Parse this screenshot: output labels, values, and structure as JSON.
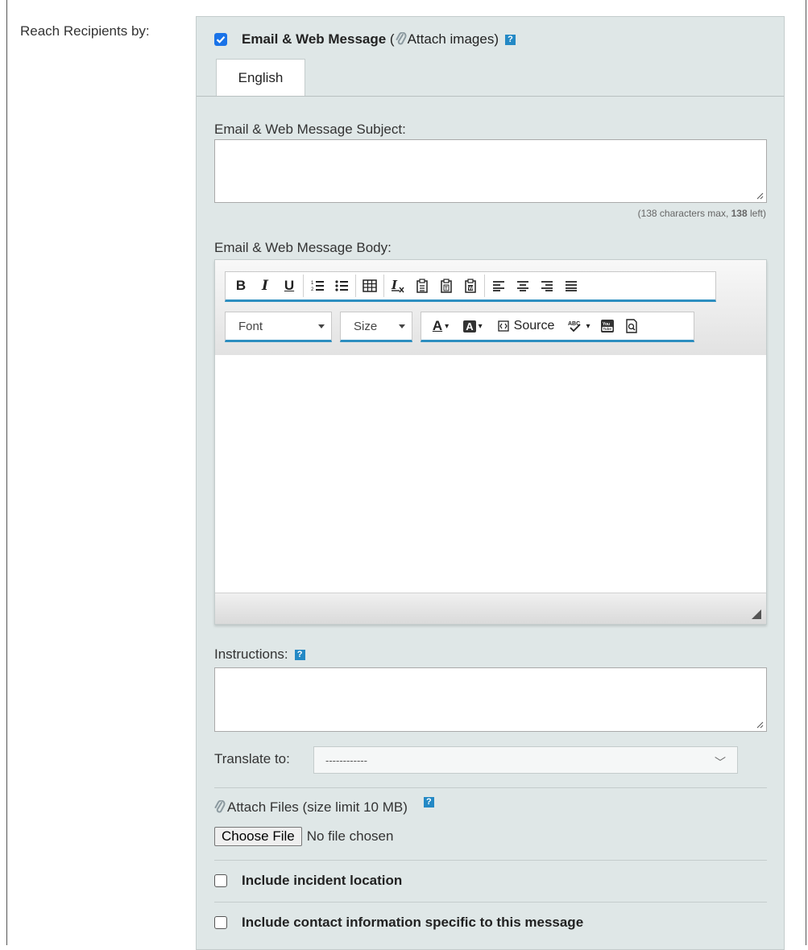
{
  "form": {
    "reach_label": "Reach Recipients by:"
  },
  "email": {
    "checkbox_label": "Email & Web Message",
    "paren_open": " (",
    "attach_images": "Attach images)",
    "help": "?",
    "checked": true
  },
  "tabs": [
    {
      "label": "English",
      "active": true
    }
  ],
  "subject": {
    "label": "Email & Web Message Subject:",
    "value": "",
    "hint_prefix": "(138 characters max, ",
    "hint_count": "138",
    "hint_suffix": " left)"
  },
  "body": {
    "label": "Email & Web Message Body:",
    "toolbar": {
      "bold": "B",
      "italic": "I",
      "underline": "U",
      "font": "Font",
      "size": "Size",
      "text_color": "A",
      "bg_color": "A",
      "source": "Source"
    },
    "icons": [
      "numbered-list-icon",
      "bulleted-list-icon",
      "table-icon",
      "remove-format-icon",
      "paste-icon",
      "paste-text-icon",
      "paste-word-icon",
      "align-left-icon",
      "align-center-icon",
      "align-right-icon",
      "justify-icon",
      "source-icon",
      "spellcheck-icon",
      "youtube-icon",
      "preview-icon"
    ]
  },
  "instructions": {
    "label": "Instructions:",
    "help": "?",
    "value": ""
  },
  "translate": {
    "label": "Translate to:",
    "selected": "------------"
  },
  "attach_files": {
    "label": "Attach Files (size limit 10 MB)",
    "help": "?",
    "button": "Choose File",
    "status": "No file chosen"
  },
  "options": [
    {
      "label": "Include incident location",
      "checked": false
    },
    {
      "label": "Include contact information specific to this message",
      "checked": false
    }
  ],
  "colors": {
    "panel": "#dfe7e7",
    "accent": "#2c8ec0",
    "checkbox": "#1a73e8"
  }
}
